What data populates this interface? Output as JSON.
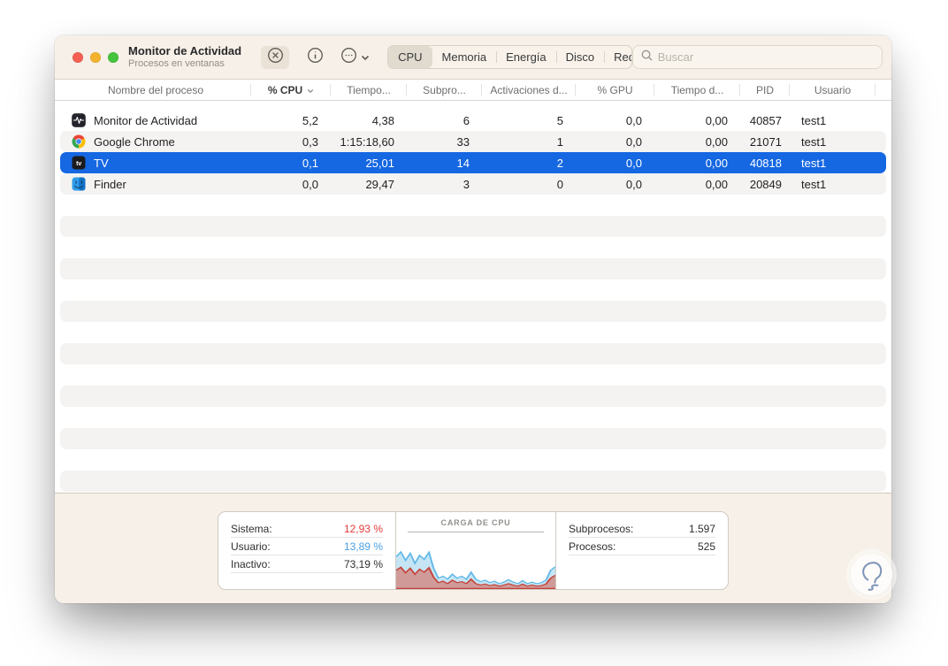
{
  "window": {
    "title": "Monitor de Actividad",
    "subtitle": "Procesos en ventanas"
  },
  "toolbar": {
    "tabs": [
      "CPU",
      "Memoria",
      "Energía",
      "Disco",
      "Red"
    ],
    "active_tab": "CPU",
    "search_placeholder": "Buscar"
  },
  "table": {
    "columns": [
      "Nombre del proceso",
      "% CPU",
      "Tiempo...",
      "Subpro...",
      "Activaciones d...",
      "% GPU",
      "Tiempo d...",
      "PID",
      "Usuario"
    ],
    "sort_column": "% CPU",
    "rows": [
      {
        "icon": "activity-monitor-icon",
        "name": "Monitor de Actividad",
        "cpu": "5,2",
        "tiempo": "4,38",
        "subpro": "6",
        "activaciones": "5",
        "gpu": "0,0",
        "tiempo_d": "0,00",
        "pid": "40857",
        "usuario": "test1",
        "selected": false
      },
      {
        "icon": "chrome-icon",
        "name": "Google Chrome",
        "cpu": "0,3",
        "tiempo": "1:15:18,60",
        "subpro": "33",
        "activaciones": "1",
        "gpu": "0,0",
        "tiempo_d": "0,00",
        "pid": "21071",
        "usuario": "test1",
        "selected": false
      },
      {
        "icon": "tv-icon",
        "name": "TV",
        "cpu": "0,1",
        "tiempo": "25,01",
        "subpro": "14",
        "activaciones": "2",
        "gpu": "0,0",
        "tiempo_d": "0,00",
        "pid": "40818",
        "usuario": "test1",
        "selected": true
      },
      {
        "icon": "finder-icon",
        "name": "Finder",
        "cpu": "0,0",
        "tiempo": "29,47",
        "subpro": "3",
        "activaciones": "0",
        "gpu": "0,0",
        "tiempo_d": "0,00",
        "pid": "20849",
        "usuario": "test1",
        "selected": false
      }
    ]
  },
  "footer": {
    "cpu_stats": [
      {
        "label": "Sistema:",
        "value": "12,93 %",
        "color": "#e23a39"
      },
      {
        "label": "Usuario:",
        "value": "13,89 %",
        "color": "#4ba0e0"
      },
      {
        "label": "Inactivo:",
        "value": "73,19 %",
        "color": "#2e2e30"
      }
    ],
    "chart_title": "CARGA DE CPU",
    "process_stats": [
      {
        "label": "Subprocesos:",
        "value": "1.597"
      },
      {
        "label": "Procesos:",
        "value": "525"
      }
    ]
  },
  "colors": {
    "selection_blue": "#1567e2",
    "row_stripe": "#f4f3f1",
    "system_red": "#e23a39",
    "user_blue": "#4ba0e0",
    "window_chrome": "#f6f0e8"
  },
  "chart_data": {
    "type": "area",
    "title": "CARGA DE CPU",
    "ylim": [
      0,
      100
    ],
    "grid": false,
    "legend_position": "none",
    "series": [
      {
        "name": "Usuario (total carga)",
        "color": "#62b9e8",
        "fill": "#c5e5f4",
        "values": [
          65,
          75,
          58,
          72,
          52,
          68,
          60,
          74,
          42,
          22,
          26,
          20,
          30,
          22,
          26,
          20,
          34,
          20,
          15,
          18,
          13,
          16,
          11,
          14,
          19,
          14,
          11,
          17,
          11,
          14,
          11,
          13,
          18,
          38,
          45
        ]
      },
      {
        "name": "Sistema",
        "color": "#c63f38",
        "fill": "#cf9a97",
        "values": [
          38,
          44,
          33,
          42,
          30,
          40,
          34,
          43,
          24,
          13,
          16,
          11,
          18,
          13,
          15,
          11,
          20,
          11,
          8,
          10,
          7,
          9,
          6,
          8,
          11,
          8,
          6,
          10,
          6,
          8,
          6,
          7,
          10,
          22,
          28
        ]
      }
    ]
  }
}
